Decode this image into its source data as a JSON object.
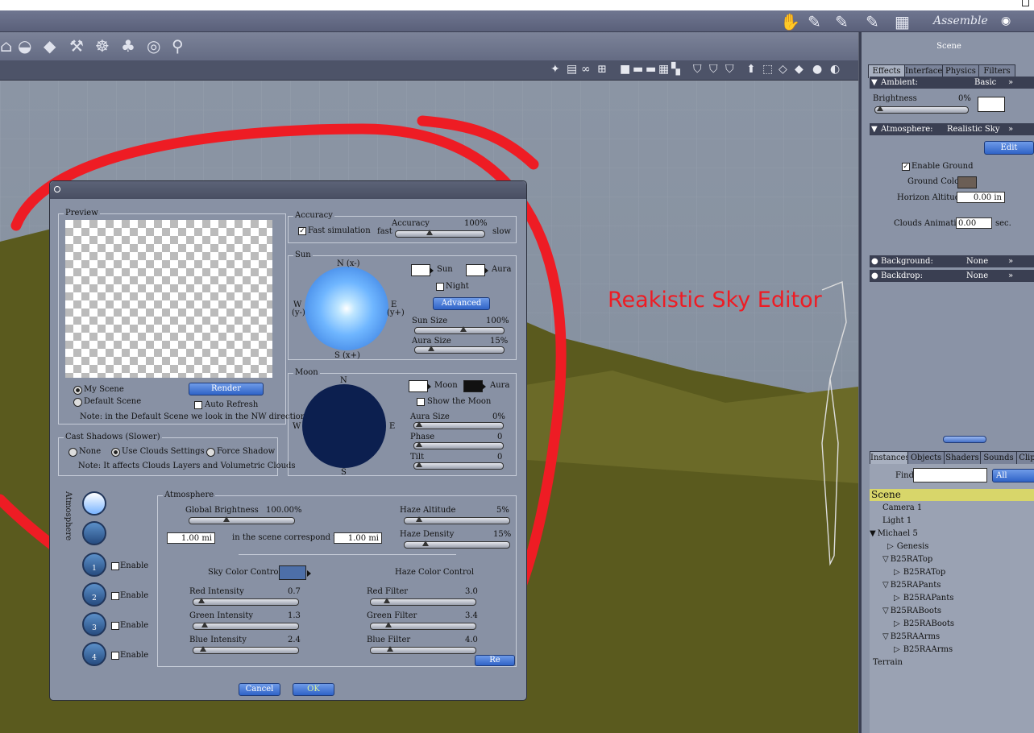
{
  "app": {
    "mode_label": "Assemble"
  },
  "right_panel": {
    "title": "Scene",
    "tabs": [
      "Effects",
      "Interface",
      "Physics",
      "Filters"
    ],
    "ambient": {
      "label": "Ambient:",
      "preset": "Basic",
      "brightness_label": "Brightness",
      "brightness_value": "0%"
    },
    "atmosphere": {
      "label": "Atmosphere:",
      "preset": "Realistic Sky",
      "edit_label": "Edit",
      "enable_ground_label": "Enable Ground",
      "ground_color_label": "Ground Color",
      "horizon_altitude_label": "Horizon Altitude",
      "horizon_altitude_value": "0.00 in",
      "clouds_animation_label": "Clouds Animation",
      "clouds_animation_value": "0.00",
      "clouds_animation_unit": "sec."
    },
    "background": {
      "label": "Background:",
      "value": "None"
    },
    "backdrop": {
      "label": "Backdrop:",
      "value": "None"
    },
    "lower_tabs": [
      "Instances",
      "Objects",
      "Shaders",
      "Sounds",
      "Clips"
    ],
    "find_label": "Find:",
    "find_filter": "All",
    "tree": [
      "Scene",
      "Camera 1",
      "Light 1",
      "Michael 5",
      "Genesis",
      "B25RATop",
      "B25RATop",
      "B25RAPants",
      "B25RAPants",
      "B25RABoots",
      "B25RABoots",
      "B25RAArms",
      "B25RAArms",
      "Terrain"
    ]
  },
  "annotation": {
    "text": "Reakistic Sky Editor"
  },
  "dialog": {
    "preview": {
      "title": "Preview",
      "my_scene": "My Scene",
      "default_scene": "Default Scene",
      "render": "Render",
      "auto_refresh": "Auto Refresh",
      "note": "Note: in the Default Scene we look in the NW direction"
    },
    "accuracy": {
      "title": "Accuracy",
      "fast_simulation": "Fast simulation",
      "accuracy_label": "Accuracy",
      "accuracy_value": "100%",
      "fast": "fast",
      "slow": "slow"
    },
    "sun": {
      "title": "Sun",
      "n": "N (x-)",
      "w": "W",
      "wy": "(y-)",
      "e": "E",
      "ey": "(y+)",
      "s": "S (x+)",
      "sun_label": "Sun",
      "aura_label": "Aura",
      "night_label": "Night",
      "advanced": "Advanced",
      "sun_size_label": "Sun Size",
      "sun_size_value": "100%",
      "aura_size_label": "Aura Size",
      "aura_size_value": "15%"
    },
    "moon": {
      "title": "Moon",
      "n": "N",
      "w": "W",
      "e": "E",
      "s": "S",
      "moon_label": "Moon",
      "aura_label": "Aura",
      "show_moon": "Show the Moon",
      "aura_size_label": "Aura Size",
      "aura_size_value": "0%",
      "phase_label": "Phase",
      "phase_value": "0",
      "tilt_label": "Tilt",
      "tilt_value": "0"
    },
    "cast_shadows": {
      "title": "Cast Shadows (Slower)",
      "none": "None",
      "use_clouds": "Use Clouds Settings",
      "force": "Force Shadow",
      "note": "Note: It affects Clouds Layers and Volumetric Clouds"
    },
    "side_label": "Atmosphere",
    "layers": [
      {
        "num": "1",
        "enable": "Enable"
      },
      {
        "num": "2",
        "enable": "Enable"
      },
      {
        "num": "3",
        "enable": "Enable"
      },
      {
        "num": "4",
        "enable": "Enable"
      }
    ],
    "atmosphere": {
      "title": "Atmosphere",
      "global_brightness_label": "Global Brightness",
      "global_brightness_value": "100.00%",
      "haze_altitude_label": "Haze Altitude",
      "haze_altitude_value": "5%",
      "haze_density_label": "Haze Density",
      "haze_density_value": "15%",
      "scale_left": "1.00 mi",
      "scale_text": "in the scene correspond to",
      "scale_right": "1.00 mi",
      "sky_color_control": "Sky Color Control",
      "haze_color_control": "Haze Color Control",
      "red_intensity_label": "Red Intensity",
      "red_intensity_value": "0.7",
      "green_intensity_label": "Green Intensity",
      "green_intensity_value": "1.3",
      "blue_intensity_label": "Blue Intensity",
      "blue_intensity_value": "2.4",
      "red_filter_label": "Red Filter",
      "red_filter_value": "3.0",
      "green_filter_label": "Green Filter",
      "green_filter_value": "3.4",
      "blue_filter_label": "Blue Filter",
      "blue_filter_value": "4.0",
      "reset": "Re"
    },
    "cancel": "Cancel",
    "ok": "OK"
  },
  "colors": {
    "annotation_red": "#ee1c24",
    "sun_sky": "#6fb6ff",
    "moon_disc": "#0c1f4f",
    "terrain": "#5a5a1e",
    "scene_row": "#d8d66a"
  }
}
